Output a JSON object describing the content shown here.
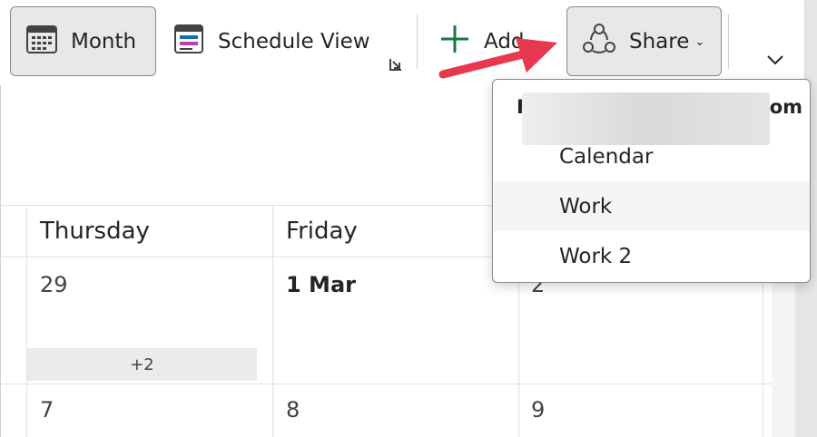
{
  "toolbar": {
    "month_label": "Month",
    "schedule_view_label": "Schedule View",
    "add_label": "Add",
    "share_label": "Share"
  },
  "calendar": {
    "days": [
      "Thursday",
      "Friday"
    ],
    "week1": [
      "29",
      "1 Mar",
      "2"
    ],
    "more_events": "+2",
    "week2": [
      "7",
      "8",
      "9"
    ]
  },
  "share_menu": {
    "account_start": "F",
    "account_end": "om",
    "items": [
      "Calendar",
      "Work",
      "Work 2"
    ]
  },
  "colors": {
    "accent_green": "#107c41",
    "annotation_red": "#e8384f"
  },
  "icons": [
    "calendar-month-icon",
    "schedule-view-icon",
    "plus-icon",
    "share-icon",
    "chevron-down-icon",
    "dialog-launcher-icon"
  ]
}
